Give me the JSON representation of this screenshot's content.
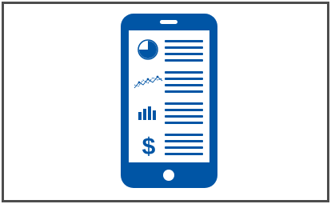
{
  "illustration": {
    "subject": "mobile-finance-dashboard",
    "colors": {
      "phone_body": "#0055a5",
      "screen": "#ffffff",
      "frame_border": "#4d4d4d",
      "background": "#ffffff"
    },
    "icons": [
      "pie-chart-icon",
      "line-chart-icon",
      "bar-chart-icon",
      "dollar-sign-icon"
    ],
    "currency_symbol": "$"
  }
}
